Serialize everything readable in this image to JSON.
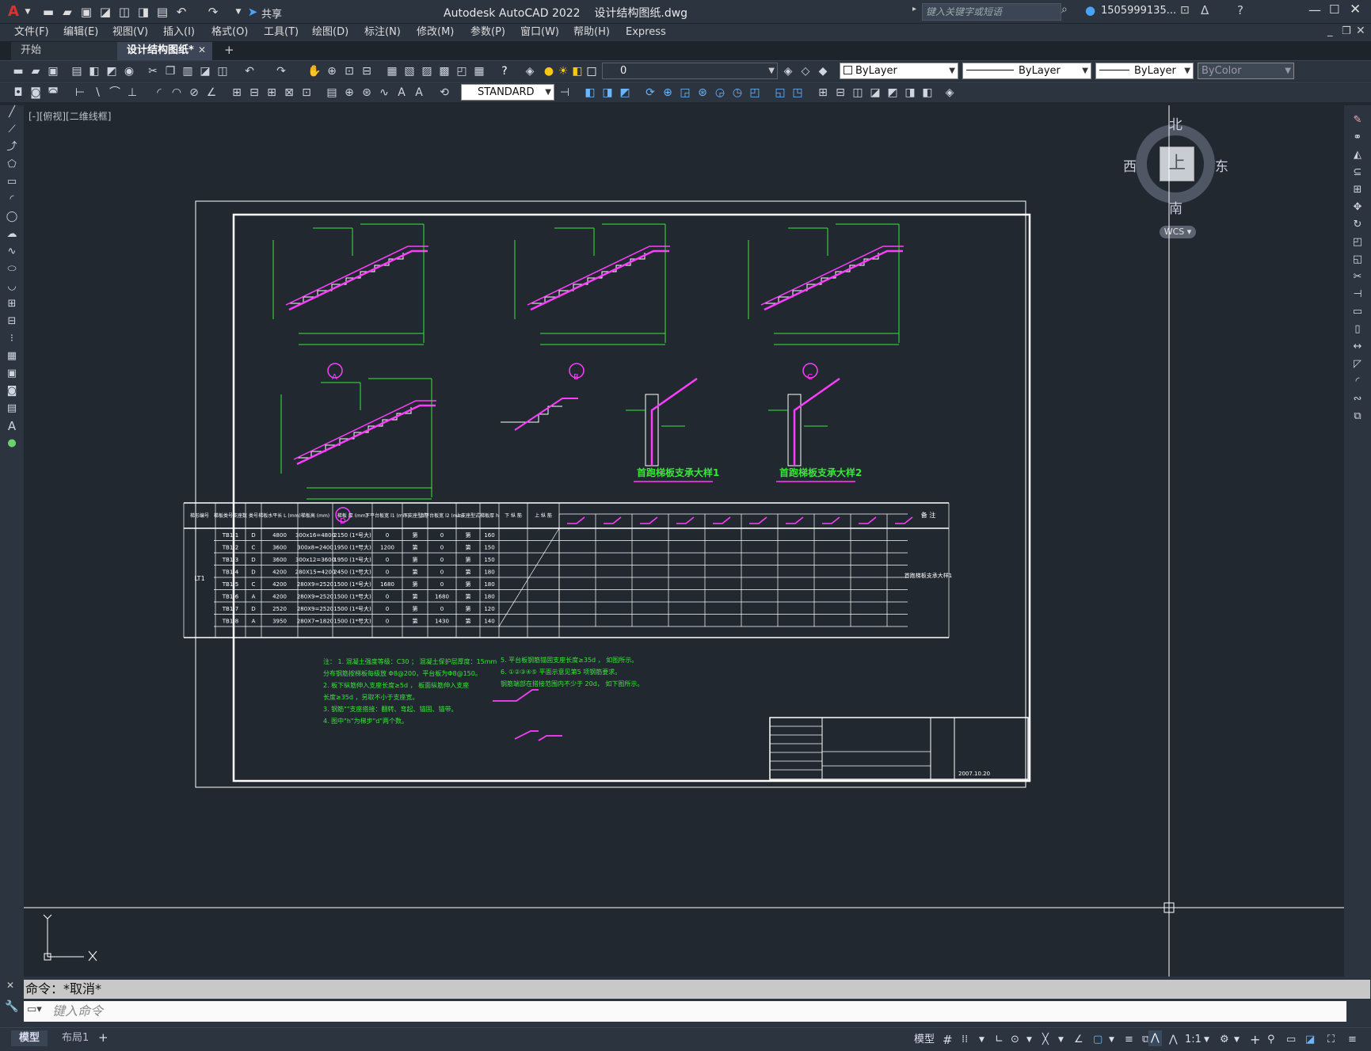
{
  "app": {
    "title": "Autodesk AutoCAD 2022",
    "filename": "设计结构图纸.dwg",
    "share_label": "共享",
    "search_placeholder": "键入关键字或短语",
    "user_name": "1505999135..."
  },
  "menu": [
    "文件(F)",
    "编辑(E)",
    "视图(V)",
    "插入(I)",
    "格式(O)",
    "工具(T)",
    "绘图(D)",
    "标注(N)",
    "修改(M)",
    "参数(P)",
    "窗口(W)",
    "帮助(H)",
    "Express"
  ],
  "tabs": {
    "start": "开始",
    "active": "设计结构图纸*",
    "add": "+"
  },
  "toolbar": {
    "layer_value": "0",
    "color_value": "ByLayer",
    "linetype_value": "ByLayer",
    "lineweight_value": "ByLayer",
    "plotstyle_value": "ByColor",
    "textstyle_value": "STANDARD"
  },
  "viewport_label": "[-][俯视][二维线框]",
  "viewcube": {
    "north": "北",
    "south": "南",
    "east": "东",
    "west": "西",
    "face": "上",
    "ucs": "WCS"
  },
  "drawing": {
    "details": [
      "A",
      "B",
      "C",
      "D"
    ],
    "support_titles": [
      "首跑梯板支承大样1",
      "首跑梯板支承大样2"
    ],
    "table_headers": [
      "梯形编号",
      "梯板类号支座数",
      "类号",
      "梯板水平长 L (mm)",
      "梯板高 (mm)",
      "梯板 厚 (mm)",
      "下平台板宽 l1 (mm)",
      "下支座型式",
      "上平台板宽 l2 (mm)",
      "上支座型式",
      "梯板厚 h",
      "下 纵 筋",
      "上 纵 筋"
    ],
    "group_label": "LT1",
    "rows": [
      [
        "TB1-1",
        "D",
        "4800",
        "300x16=4800",
        "2150 (1*号大)",
        "0",
        "第",
        "0",
        "第",
        "160"
      ],
      [
        "TB1-2",
        "C",
        "3600",
        "300x8=2400",
        "1950 (1*号大)",
        "1200",
        "第",
        "0",
        "第",
        "150"
      ],
      [
        "TB1-3",
        "D",
        "3600",
        "300x12=3600",
        "1950 (1*号大)",
        "0",
        "第",
        "0",
        "第",
        "150"
      ],
      [
        "TB1-4",
        "D",
        "4200",
        "280X15=4200",
        "2450 (1*号大)",
        "0",
        "第",
        "0",
        "第",
        "180"
      ],
      [
        "TB1-5",
        "C",
        "4200",
        "280X9=2520",
        "1500 (1*号大)",
        "1680",
        "第",
        "0",
        "第",
        "180"
      ],
      [
        "TB1-6",
        "A",
        "4200",
        "280X9=2520",
        "1500 (1*号大)",
        "0",
        "第",
        "1680",
        "第",
        "180"
      ],
      [
        "TB1-7",
        "D",
        "2520",
        "280X9=2520",
        "1500 (1*号大)",
        "0",
        "第",
        "0",
        "第",
        "120"
      ],
      [
        "TB1-8",
        "A",
        "3950",
        "280X7=1820",
        "1500 (1*号大)",
        "0",
        "第",
        "1430",
        "第",
        "140"
      ]
    ],
    "remark": "首跑梯板支承大样1",
    "remark_header": "备 注",
    "notes_left": [
      "注： 1. 混凝土强度等级：C30 ； 混凝土保护层厚度：15mm",
      "   分布钢筋按梯板每级放 Φ8@200，平台板为Φ8@150。",
      "2. 板下纵筋伸入支座长度≥5d ， 板面纵筋伸入支座",
      "   长度≥35d ，另取不小于支座宽。",
      "3. 钢筋\"\"支座搭接：翻转、弯起、锚固、锚带。",
      "4. 图中\"h\"为梯步\"d\"两个数。"
    ],
    "notes_right": [
      "5. 平台板钢筋锚固支座长度≥35d ， 如图所示。",
      "6. ①②③④⑤ 平面示意见第5 项钢筋要求。",
      "   钢筋端部在搭接范围内不少于 20d， 如下图所示。"
    ],
    "tb_date": "2007.10.20"
  },
  "command": {
    "history": "命令：*取消*",
    "placeholder": "键入命令"
  },
  "status": {
    "model_tab": "模型",
    "layout_tab": "布局1",
    "model_label": "模型",
    "scale": "1:1"
  }
}
